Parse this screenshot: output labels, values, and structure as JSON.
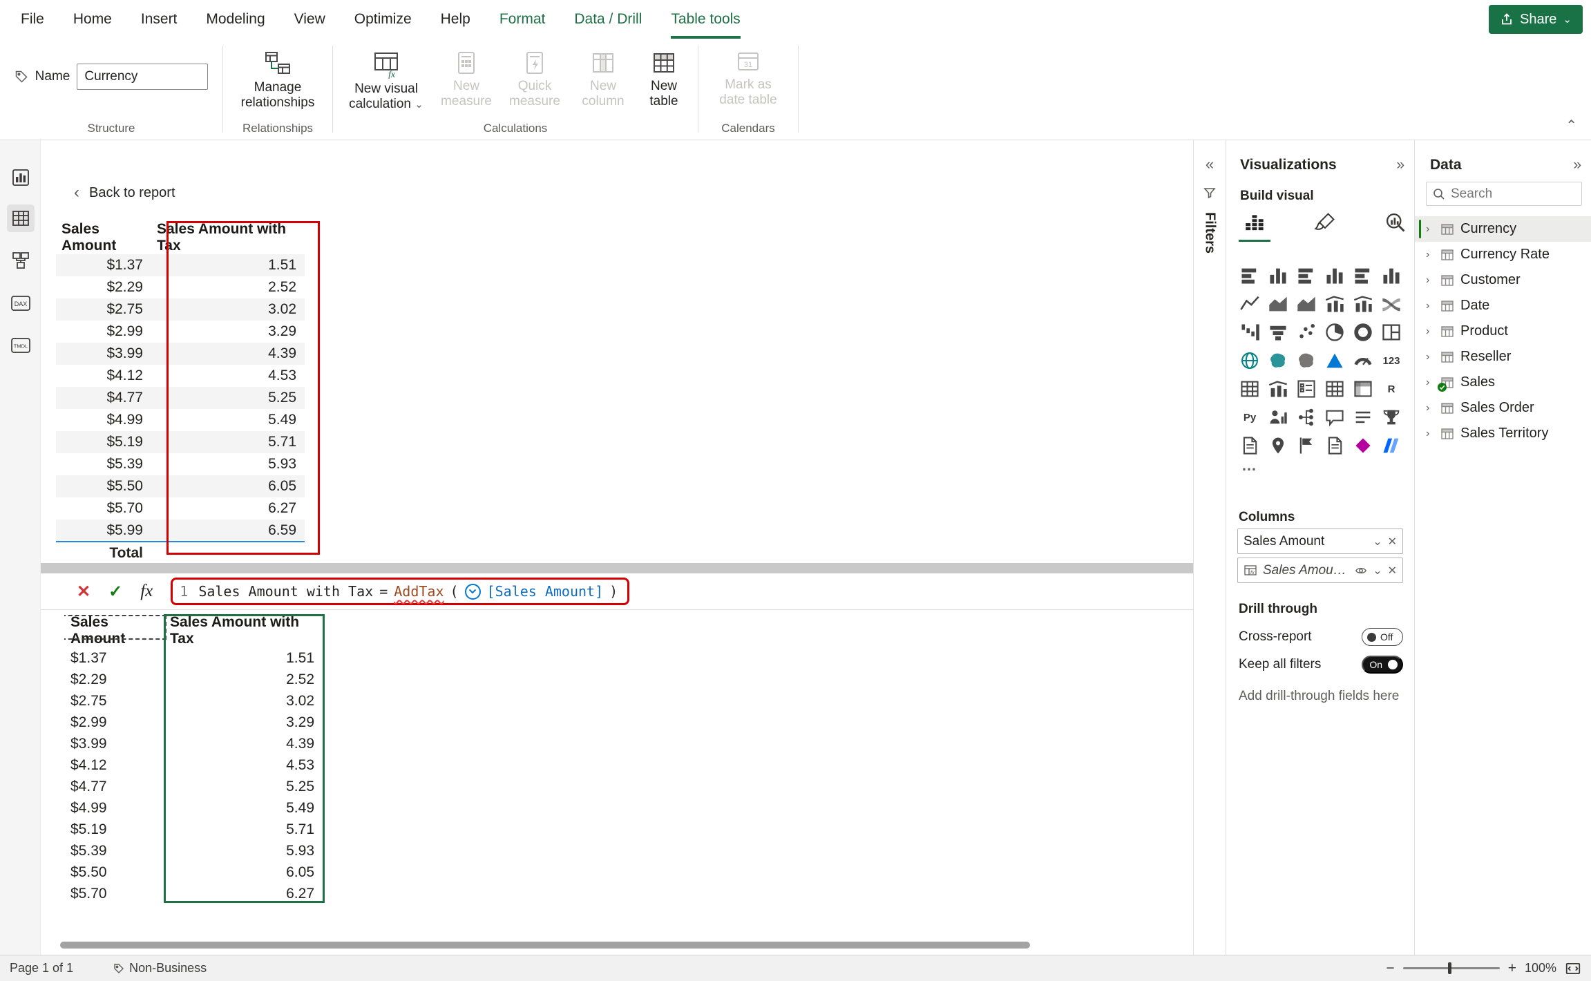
{
  "menubar": {
    "items": [
      {
        "label": "File"
      },
      {
        "label": "Home"
      },
      {
        "label": "Insert"
      },
      {
        "label": "Modeling"
      },
      {
        "label": "View"
      },
      {
        "label": "Optimize"
      },
      {
        "label": "Help"
      },
      {
        "label": "Format",
        "accent": true
      },
      {
        "label": "Data / Drill",
        "accent": true
      },
      {
        "label": "Table tools",
        "accent": true,
        "active": true
      }
    ],
    "share_label": "Share"
  },
  "ribbon": {
    "structure_group_label": "Structure",
    "relationships_group_label": "Relationships",
    "calculations_group_label": "Calculations",
    "calendars_group_label": "Calendars",
    "name_label": "Name",
    "name_value": "Currency",
    "manage_relationships_label": "Manage relationships",
    "new_visual_calculation_label": "New visual calculation",
    "new_measure_label": "New measure",
    "quick_measure_label": "Quick measure",
    "new_column_label": "New column",
    "new_table_label": "New table",
    "mark_as_date_table_label": "Mark as date table"
  },
  "view_rail": {
    "views": [
      "report-view",
      "table-view",
      "model-view",
      "dax-query-view",
      "tmdl-view"
    ],
    "active_view": "table-view"
  },
  "canvas": {
    "back_label": "Back to report",
    "table": {
      "col1": "Sales Amount",
      "col2": "Sales Amount with Tax",
      "rows": [
        [
          "$1.37",
          "1.51"
        ],
        [
          "$2.29",
          "2.52"
        ],
        [
          "$2.75",
          "3.02"
        ],
        [
          "$2.99",
          "3.29"
        ],
        [
          "$3.99",
          "4.39"
        ],
        [
          "$4.12",
          "4.53"
        ],
        [
          "$4.77",
          "5.25"
        ],
        [
          "$4.99",
          "5.49"
        ],
        [
          "$5.19",
          "5.71"
        ],
        [
          "$5.39",
          "5.93"
        ],
        [
          "$5.50",
          "6.05"
        ],
        [
          "$5.70",
          "6.27"
        ],
        [
          "$5.99",
          "6.59"
        ]
      ],
      "total_label": "Total"
    },
    "formula": {
      "fx_label": "fx",
      "line_number": "1",
      "lhs": "Sales Amount with Tax",
      "equals": "=",
      "function_name": "AddTax",
      "open_paren": "(",
      "column_ref": "[Sales Amount]",
      "close_paren": ")"
    }
  },
  "filters_pane": {
    "title": "Filters"
  },
  "visualizations": {
    "title": "Visualizations",
    "build_visual_label": "Build visual",
    "more_label": "…",
    "columns_label": "Columns",
    "field_wells": [
      {
        "label": "Sales Amount"
      },
      {
        "label": "Sales Amount ...",
        "italic": true
      }
    ],
    "drill_through_label": "Drill through",
    "cross_report_label": "Cross-report",
    "cross_report_state": "Off",
    "keep_all_filters_label": "Keep all filters",
    "keep_all_filters_state": "On",
    "drop_hint": "Add drill-through fields here",
    "visual_icons": [
      [
        "stacked-bar-chart",
        "bars-h"
      ],
      [
        "stacked-column-chart",
        "bars-v"
      ],
      [
        "clustered-bar-chart",
        "bars-h"
      ],
      [
        "clustered-column-chart",
        "bars-v"
      ],
      [
        "100-stacked-bar-chart",
        "bars-h"
      ],
      [
        "100-stacked-column-chart",
        "bars-v"
      ],
      [
        "line-chart",
        "line"
      ],
      [
        "area-chart",
        "area"
      ],
      [
        "stacked-area-chart",
        "area"
      ],
      [
        "line-and-stacked-column-chart",
        "combo"
      ],
      [
        "line-and-clustered-column-chart",
        "combo"
      ],
      [
        "ribbon-chart",
        "ribbon"
      ],
      [
        "waterfall-chart",
        "waterfall"
      ],
      [
        "funnel-chart",
        "funnel"
      ],
      [
        "scatter-chart",
        "scatter"
      ],
      [
        "pie-chart",
        "pie"
      ],
      [
        "donut-chart",
        "donut"
      ],
      [
        "treemap",
        "treemap"
      ],
      [
        "map",
        "globe",
        "#038387"
      ],
      [
        "filled-map",
        "blob",
        "#038387"
      ],
      [
        "shape-map",
        "blob",
        "#605e5c"
      ],
      [
        "azure-map",
        "triangle",
        "#0078d4"
      ],
      [
        "gauge",
        "gauge"
      ],
      [
        "card",
        "text",
        "123"
      ],
      [
        "multi-row-card",
        "grid"
      ],
      [
        "kpi",
        "combo"
      ],
      [
        "slicer",
        "slicer"
      ],
      [
        "table",
        "grid"
      ],
      [
        "matrix",
        "matrix"
      ],
      [
        "r-script-visual",
        "text",
        "R"
      ],
      [
        "python-visual",
        "text",
        "Py"
      ],
      [
        "key-influencers",
        "person"
      ],
      [
        "decomposition-tree",
        "tree"
      ],
      [
        "qa-visual",
        "bubble"
      ],
      [
        "smart-narrative",
        "lines"
      ],
      [
        "metrics",
        "cup"
      ],
      [
        "paginated-report",
        "page"
      ],
      [
        "arcgis-map",
        "pin"
      ],
      [
        "scorecard",
        "flag"
      ],
      [
        "workbook",
        "page"
      ],
      [
        "power-apps",
        "diamond",
        "#b4009e"
      ],
      [
        "power-automate",
        "slashes",
        "#0066ff"
      ]
    ]
  },
  "data_pane": {
    "title": "Data",
    "search_placeholder": "Search",
    "tables": [
      {
        "name": "Currency",
        "selected": true
      },
      {
        "name": "Currency Rate"
      },
      {
        "name": "Customer"
      },
      {
        "name": "Date"
      },
      {
        "name": "Product"
      },
      {
        "name": "Reseller"
      },
      {
        "name": "Sales",
        "checked": true
      },
      {
        "name": "Sales Order"
      },
      {
        "name": "Sales Territory"
      }
    ]
  },
  "status_bar": {
    "page_label": "Page 1 of 1",
    "sensitivity_label": "Non-Business",
    "zoom_out": "−",
    "zoom_in": "+",
    "zoom_percent": "100%"
  },
  "icons_text": {
    "collapse_right": "»",
    "expand_left": "«",
    "chevron_down": "⌄",
    "close": "✕",
    "check": "✓",
    "ribbon_collapse": "⌃",
    "back_chevron": "‹",
    "row_chevron": "›"
  },
  "colors": {
    "accent_green": "#1e7145",
    "annotation_red": "#d40000",
    "selection_green": "#1e7145",
    "selection_blue": "#0078d4"
  }
}
